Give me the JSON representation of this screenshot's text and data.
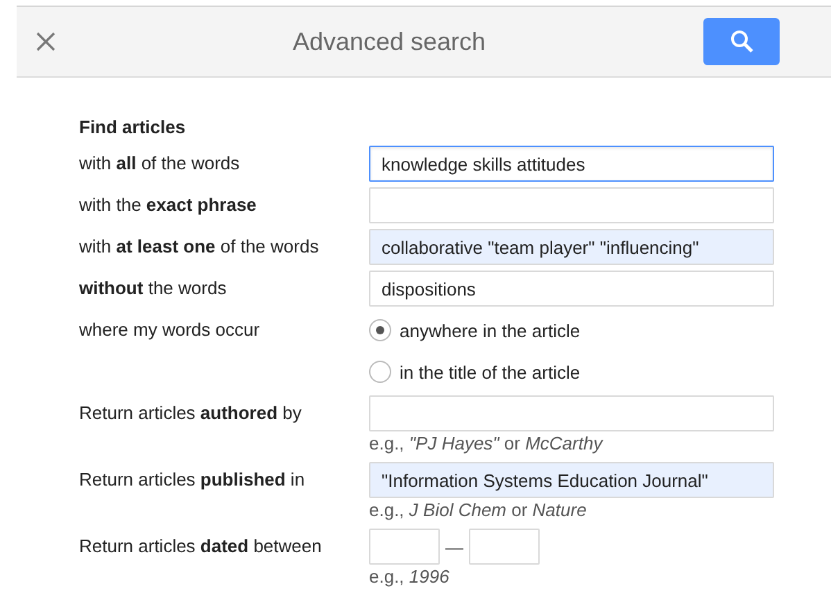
{
  "dialog": {
    "title": "Advanced search"
  },
  "section_title": "Find articles",
  "rows": [
    {
      "kind": "text",
      "label": "with **all** of the words",
      "value": "knowledge skills attitudes",
      "focused": true,
      "autofilled": false
    },
    {
      "kind": "text",
      "label": "with the **exact phrase**",
      "focused": false,
      "autofilled": false
    },
    {
      "kind": "text",
      "label": "with **at least one** of the words",
      "value": "collaborative \"team player\" \"influencing\"",
      "focused": false,
      "autofilled": true
    },
    {
      "kind": "text",
      "label": "**without** the words",
      "value": "dispositions",
      "focused": false,
      "autofilled": false
    },
    {
      "kind": "radio",
      "label": "where my words occur",
      "options": [
        {
          "label": "anywhere in the article",
          "selected": true
        },
        {
          "label": "in the title of the article",
          "selected": false
        }
      ]
    },
    {
      "kind": "text",
      "label": "Return articles **authored** by",
      "hint": "e.g., *\"PJ Hayes\"* or *McCarthy*",
      "focused": false,
      "autofilled": false
    },
    {
      "kind": "text",
      "label": "Return articles **published** in",
      "value": "\"Information Systems Education Journal\"",
      "hint": "e.g., *J Biol Chem* or *Nature*",
      "focused": false,
      "autofilled": true
    },
    {
      "kind": "range",
      "label": "Return articles **dated** between",
      "separator": "—",
      "hint": "e.g., *1996*"
    }
  ]
}
